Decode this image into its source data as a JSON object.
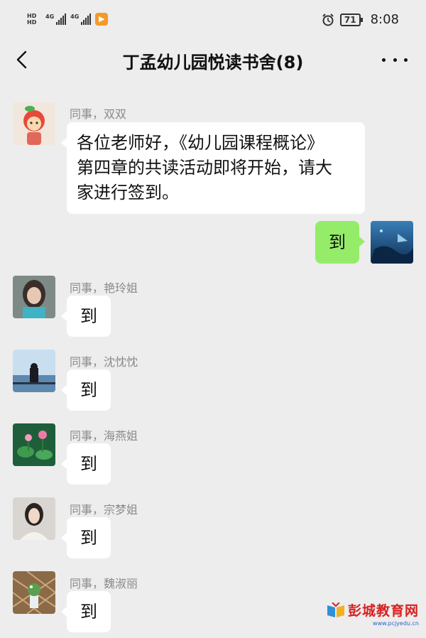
{
  "status_bar": {
    "network_1": "HD",
    "network_2": "HD",
    "signal_1_label": "4G",
    "signal_2_label": "4G",
    "app_icon": "play-badge-icon",
    "alarm_icon": "alarm-clock-icon",
    "battery": "71",
    "time": "8:08"
  },
  "nav": {
    "back_icon": "back-chevron-icon",
    "title": "丁孟幼儿园悦读书舍(8)",
    "more_icon": "more-dots-icon"
  },
  "messages": [
    {
      "sender": "同事，双双",
      "text": "各位老师好，《幼儿园课程概论》第四章的共读活动即将开始，请大家进行签到。",
      "lines": [
        "各位老师好，《幼儿园课程概论》",
        "第四章的共读活动即将开始，请大",
        "家进行签到。"
      ]
    },
    {
      "sender": "",
      "text": "到",
      "self": true
    },
    {
      "sender": "同事，艳玲姐",
      "text": "到"
    },
    {
      "sender": "同事，沈忱忱",
      "text": "到"
    },
    {
      "sender": "同事，海燕姐",
      "text": "到"
    },
    {
      "sender": "同事，宗梦姐",
      "text": "到"
    },
    {
      "sender": "同事，魏淑丽",
      "text": "到"
    }
  ],
  "watermark": {
    "text": "彭城教育网",
    "url": "www.pcjyedu.cn"
  },
  "colors": {
    "background": "#ededed",
    "incoming_bubble": "#ffffff",
    "outgoing_bubble": "#95ec69",
    "sender_name": "#8a8a8a"
  }
}
